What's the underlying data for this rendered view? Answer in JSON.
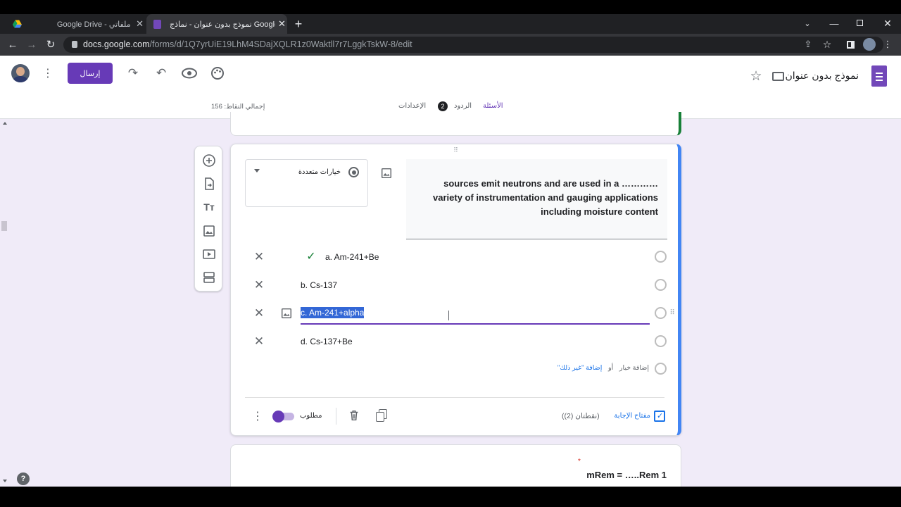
{
  "browser": {
    "tabs": [
      {
        "title": "Google Drive - ملفاتي"
      },
      {
        "title": "نموذج بدون عنوان - نماذج Google"
      }
    ],
    "url_host": "docs.google.com",
    "url_path": "/forms/d/1Q7yrUiE19LhM4SDajXQLR1z0Waktll7r7LggkTskW-8/edit"
  },
  "header": {
    "form_title": "نموذج بدون عنوان",
    "send_label": "إرسال",
    "tabs": [
      "الأسئلة",
      "الردود",
      "الإعدادات"
    ],
    "responses_count": "2",
    "total_points": "إجمالي النقاط: 156"
  },
  "question": {
    "text_lines": [
      "sources emit neutrons and are used in a …………",
      "variety of instrumentation and gauging applications",
      "including moisture content"
    ],
    "type_label": "خيارات متعددة",
    "options": [
      "a. Am-241+Be",
      "b. Cs-137",
      "c. Am-241+alpha",
      "d. Cs-137+Be"
    ],
    "correct_index": 0,
    "add_option": "إضافة خيار",
    "or_label": "أو",
    "add_other": "إضافة \"غير ذلك\"",
    "answer_key": "مفتاح الإجابة",
    "points": "(نقطتان (2))",
    "required_label": "مطلوب"
  },
  "next_question": {
    "text": "mRem = …..Rem 1",
    "required_mark": "*"
  },
  "colors": {
    "accent": "#673ab7",
    "question_border": "#4285f4",
    "green": "#188038"
  }
}
